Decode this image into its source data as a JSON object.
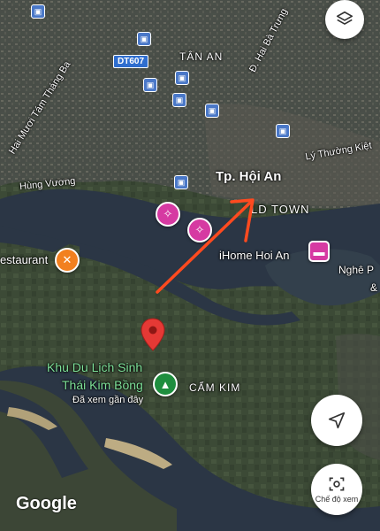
{
  "map": {
    "labels": {
      "tan_an": "TÂN AN",
      "city": "Tp. Hội An",
      "old_town": "LD TOWN",
      "hung_vuong": "Hùng Vương",
      "hai_ba_trung": "Đ. Hai Bà Trưng",
      "ly_thuong_kiet": "Lý Thường Kiệt",
      "hai_muoi_tam": "Hai Mươi Tám Tháng Ba",
      "ihome": "iHome Hoi An",
      "nghe": "Nghê P",
      "restaurant": "estaurant",
      "resort_line1": "Khu Du Lịch Sinh",
      "resort_line2": "Thái Kim Bồng",
      "resort_sub": "Đã xem gần đây",
      "cam_kim": "CẨM KIM",
      "amp": "&"
    },
    "road_shield": "DT607",
    "brand": "Google",
    "view_mode_label": "Chế độ xem",
    "colors": {
      "river": "#2b3645",
      "land": "#3f4a3a",
      "arrow": "#ff4a1f",
      "pin_red": "#e53935",
      "pin_pink": "#d63aa2",
      "pin_orange": "#f2801f",
      "park_green": "#1e8e3e"
    },
    "icons": [
      "layers-icon",
      "location-arrow-icon",
      "camera-scan-icon",
      "fork-knife-icon",
      "bed-icon",
      "tree-icon",
      "bus-icon",
      "viewpoint-icon",
      "map-pin-icon"
    ]
  }
}
